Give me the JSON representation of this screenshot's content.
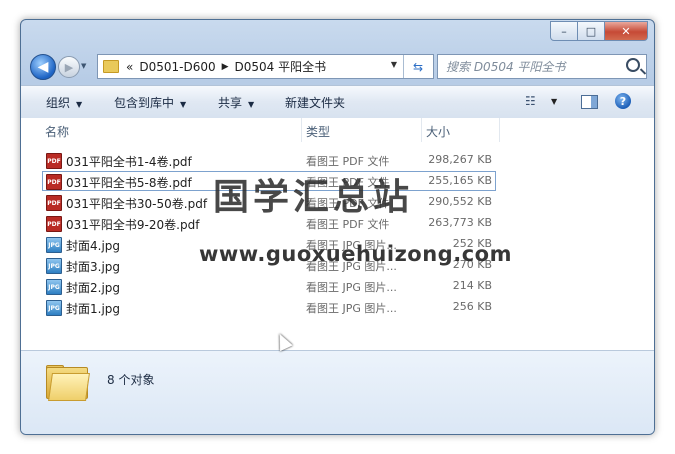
{
  "window": {
    "buttons": {
      "minimize": "–",
      "maximize": "□",
      "close": "✕"
    }
  },
  "nav": {
    "back_icon": "back-arrow-icon",
    "forward_icon": "forward-arrow-icon",
    "address": {
      "overflow": "«",
      "parts": [
        "D0501-D600",
        "D0504 平阳全书"
      ]
    },
    "search_placeholder": "搜索 D0504 平阳全书"
  },
  "toolbar": {
    "organize": "组织",
    "include_in_library": "包含到库中",
    "share": "共享",
    "new_folder": "新建文件夹"
  },
  "columns": {
    "name": "名称",
    "type": "类型",
    "size": "大小"
  },
  "files": [
    {
      "name": "031平阳全书1-4卷.pdf",
      "kind": "pdf",
      "type": "看图王 PDF 文件",
      "size": "298,267 KB"
    },
    {
      "name": "031平阳全书5-8卷.pdf",
      "kind": "pdf",
      "type": "看图王 PDF 文件",
      "size": "255,165 KB"
    },
    {
      "name": "031平阳全书30-50卷.pdf",
      "kind": "pdf",
      "type": "看图王 PDF 文件",
      "size": "290,552 KB"
    },
    {
      "name": "031平阳全书9-20卷.pdf",
      "kind": "pdf",
      "type": "看图王 PDF 文件",
      "size": "263,773 KB"
    },
    {
      "name": "封面4.jpg",
      "kind": "jpg",
      "type": "看图王 JPG 图片...",
      "size": "252 KB"
    },
    {
      "name": "封面3.jpg",
      "kind": "jpg",
      "type": "看图王 JPG 图片...",
      "size": "270 KB"
    },
    {
      "name": "封面2.jpg",
      "kind": "jpg",
      "type": "看图王 JPG 图片...",
      "size": "214 KB"
    },
    {
      "name": "封面1.jpg",
      "kind": "jpg",
      "type": "看图王 JPG 图片...",
      "size": "256 KB"
    }
  ],
  "icon_text": {
    "pdf": "PDF",
    "jpg": "JPG"
  },
  "watermark": {
    "title": "国学汇总站",
    "url": "www.guoxuehuizong.com"
  },
  "status": {
    "count": "8 个对象"
  }
}
